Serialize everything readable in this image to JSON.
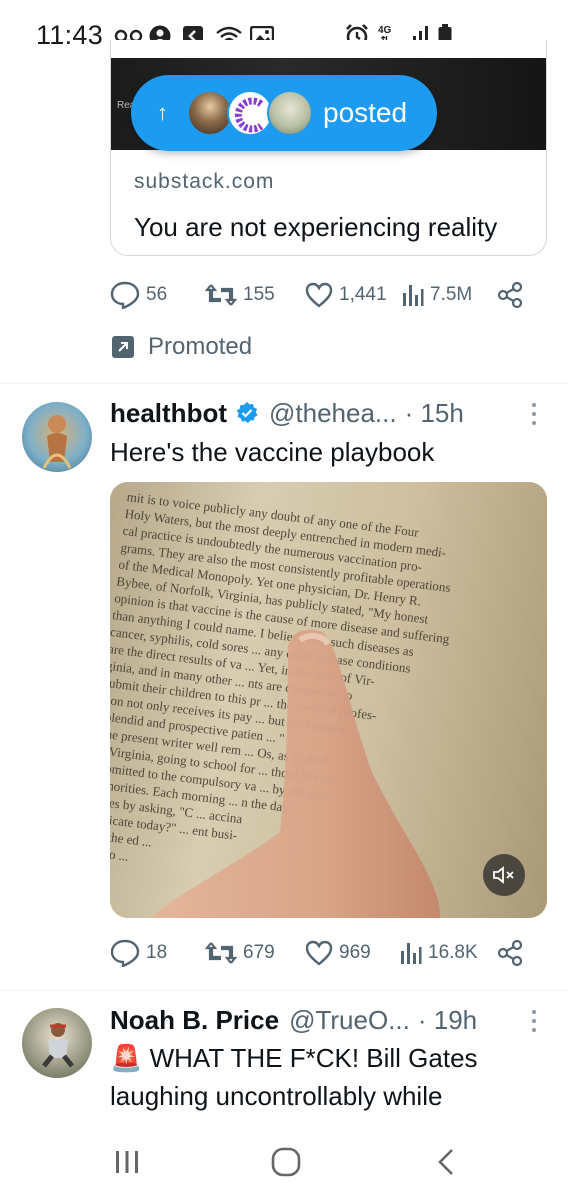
{
  "status_bar": {
    "time": "11:43",
    "icons": [
      "voicemail-icon",
      "account-icon",
      "cast-icon",
      "wifi-icon",
      "image-icon",
      "alarm-icon",
      "4g-icon",
      "signal-icon",
      "battery-icon"
    ],
    "network_label": "4G"
  },
  "quoted_card": {
    "read_label": "Read",
    "domain": "substack.com",
    "text": "You are not experiencing reality directly"
  },
  "posted_pill": {
    "label": "posted",
    "color": "#1d9bf0"
  },
  "tweet0_actions": {
    "replies": "56",
    "reposts": "155",
    "likes": "1,441",
    "views": "7.5M"
  },
  "promoted": {
    "label": "Promoted"
  },
  "tweet1": {
    "name": "healthbot",
    "verified": true,
    "handle": "@thehea...",
    "time": "· 15h",
    "text": "Here's the vaccine playbook",
    "media_lines": [
      "mit is to voice publicly any doubt of any one of the Four",
      "Holy Waters, but the most deeply entrenched in modern medi-",
      "cal practice is undoubtedly the numerous vaccination pro-",
      "grams. They are also the most consistently profitable operations",
      "of the Medical Monopoly. Yet one physician, Dr. Henry R.",
      "Bybee, of Norfolk, Virginia, has publicly stated, \"My honest",
      "opinion is that vaccine is the cause of more disease and suffering",
      "than anything I could name. I believe that such diseases as",
      "cancer, syphilis, cold sores ... any other disease conditions",
      "are the direct results of va ... Yet, in the state of Vir-",
      "ginia, and in many other ... nts are compelled to",
      "submit their children to this pr ... the medical profes-",
      "sion not only receives its pay ... but also makes",
      "splendid and prospective patien ... \"",
      "The present writer well rem ... Os, as a child",
      "in Virginia, going to school for ... thout having",
      "submitted to the compulsory va ... by the state",
      "authorities. Each morning ... n the day",
      "lasses by asking, \"C ... accina",
      "ertificate today?\" ... ent busi-",
      "s of the ed ...",
      "s as lo ..."
    ],
    "actions": {
      "replies": "18",
      "reposts": "679",
      "likes": "969",
      "views": "16.8K"
    }
  },
  "tweet2": {
    "name": "Noah B. Price",
    "handle": "@TrueO...",
    "time": "· 19h",
    "text": "🚨 WHAT THE F*CK! Bill Gates laughing uncontrollably while"
  },
  "colors": {
    "accent": "#1d9bf0",
    "text": "#0f1419",
    "secondary": "#536471",
    "verified": "#1d9bf0"
  }
}
